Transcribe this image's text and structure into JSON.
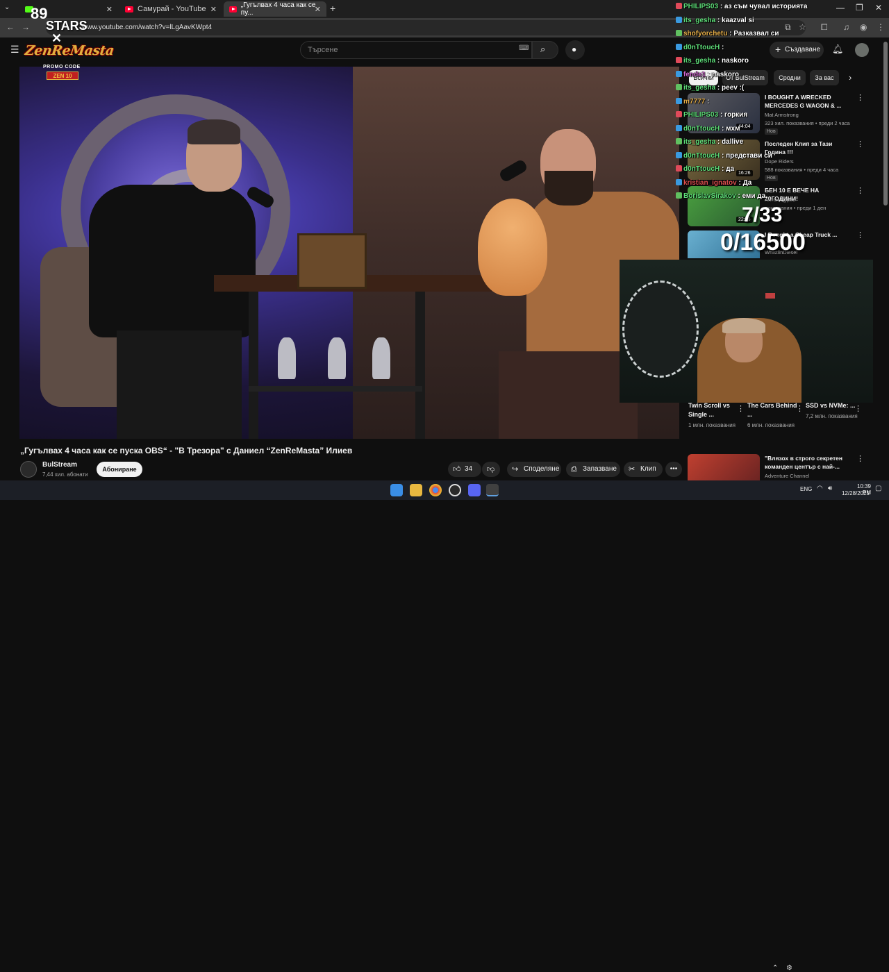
{
  "browser": {
    "tabs": [
      {
        "label": "",
        "icon": "kick-icon"
      },
      {
        "label": "Самурай - YouTube",
        "icon": "youtube-icon"
      },
      {
        "label": "„Гугълвах 4 часа как се пу...",
        "icon": "youtube-icon"
      }
    ],
    "url": "www.youtube.com/watch?v=lLgAavKWpt4"
  },
  "youtube": {
    "search_placeholder": "Търсене",
    "create_label": "Създаване"
  },
  "overlay": {
    "stars_count": "89",
    "stars_label": "STARS",
    "stars_x": "✕",
    "logo_text": "ZenReMasta",
    "promo_label": "PROMO CODE",
    "promo_code": "ZEN 10"
  },
  "video": {
    "title": "„Гугълвах 4 часа как се пуска OBS“ - \"В Трезора\" с Даниел “ZenReMasta” Илиев",
    "channel_name": "BulStream",
    "channel_subs": "7,44 хил. абонати",
    "subscribe_label": "Абониране",
    "like_count": "34",
    "share_label": "Споделяне",
    "save_label": "Запазване",
    "clip_label": "Клип"
  },
  "sidebar": {
    "chips": [
      "Всички",
      "От BulStream",
      "Сродни",
      "За вас"
    ],
    "recommendations": [
      {
        "title": "I BOUGHT A WRECKED MERCEDES G WAGON & ...",
        "channel": "Mat Armstrong",
        "meta": "323 хил. показвания • преди 2 часа",
        "badge": "Нов",
        "duration": "44:04"
      },
      {
        "title": "Последен Клип за Тази Година !!!",
        "channel": "Dope Riders",
        "meta": "588 показвания • преди 4 часа",
        "badge": "Нов",
        "duration": "16:26"
      },
      {
        "title": "БЕН 10 Е ВЕЧЕ НА 20ГОДИНИ!",
        "channel": "Антон Цурев",
        "meta": "показвания • преди 1 ден",
        "badge": "",
        "duration": "22:56"
      },
      {
        "title": "I Bought a Cheap Truck ...",
        "channel": "WhistlinDiesel",
        "meta": "",
        "badge": "",
        "duration": ""
      },
      {
        "title": "\"Влязох в строго секретен команден център с най-...",
        "channel": "Adventure Channel",
        "meta": "",
        "badge": "",
        "duration": ""
      }
    ],
    "shorts": [
      {
        "title": "Twin Scroll vs Single ...",
        "views": "1 млн. показвания"
      },
      {
        "title": "The Cars Behind ...",
        "views": "6 млн. показвания"
      },
      {
        "title": "SSD vs NVMe: ...",
        "views": "7,2 млн. показвания"
      }
    ]
  },
  "chat": [
    {
      "user": "PHILIPS03",
      "msg": ": аз съм чувал историята",
      "color": "#5fe07a"
    },
    {
      "user": "its_gesha",
      "msg": ": kaazval si",
      "color": "#5fe07a"
    },
    {
      "user": "shofyorchetu",
      "msg": ": Разказвал си",
      "color": "#e8b04a"
    },
    {
      "user": "d0nTtoucH",
      "msg": ":",
      "color": "#5fe07a"
    },
    {
      "user": "its_gesha",
      "msg": ": naskoro",
      "color": "#5fe07a"
    },
    {
      "user": "fende1",
      "msg": ": naskoro",
      "color": "#d46ad4"
    },
    {
      "user": "its_gesha",
      "msg": ": peev :(",
      "color": "#5fe07a"
    },
    {
      "user": "m7777",
      "msg": ":",
      "color": "#e8b04a"
    },
    {
      "user": "PHILIPS03",
      "msg": ": горкия",
      "color": "#5fe07a"
    },
    {
      "user": "d0nTtoucH",
      "msg": ": мхм",
      "color": "#5fe07a"
    },
    {
      "user": "its_gesha",
      "msg": ": dallive",
      "color": "#5fe07a"
    },
    {
      "user": "d0nTtoucH",
      "msg": ": представи си",
      "color": "#5fe07a"
    },
    {
      "user": "d0nTtoucH",
      "msg": ": да",
      "color": "#5fe07a"
    },
    {
      "user": "kristian_ignatov",
      "msg": ": Да",
      "color": "#e05050"
    },
    {
      "user": "BorislavSirakov",
      "msg": ": еми да.",
      "color": "#5fe07a"
    }
  ],
  "goal": {
    "line1": "7/33",
    "line2": "0/16500"
  },
  "system": {
    "lang": "ENG",
    "time": "10:39 PM",
    "date": "12/28/2025"
  }
}
